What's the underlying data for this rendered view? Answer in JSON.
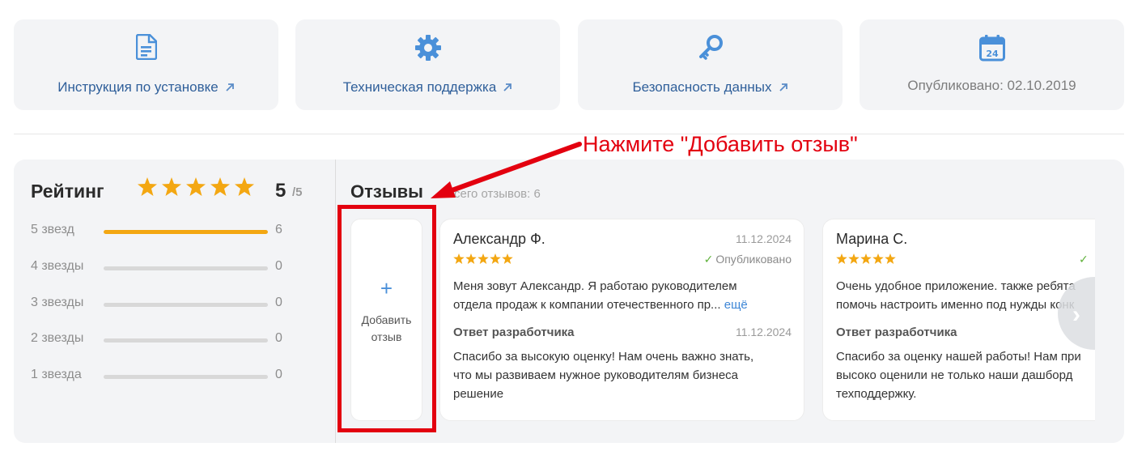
{
  "tiles": [
    {
      "label": "Инструкция по установке",
      "icon": "document-icon"
    },
    {
      "label": "Техническая поддержка",
      "icon": "gear-icon"
    },
    {
      "label": "Безопасность данных",
      "icon": "key-icon"
    },
    {
      "label": "Опубликовано: 02.10.2019",
      "icon": "calendar-icon",
      "calendar_day": "24"
    }
  ],
  "rating": {
    "title": "Рейтинг",
    "score": "5",
    "max": "/5",
    "rows": [
      {
        "label": "5 звезд",
        "count": "6",
        "fraction": 1.0
      },
      {
        "label": "4 звезды",
        "count": "0",
        "fraction": 0
      },
      {
        "label": "3 звезды",
        "count": "0",
        "fraction": 0
      },
      {
        "label": "2 звезды",
        "count": "0",
        "fraction": 0
      },
      {
        "label": "1 звезда",
        "count": "0",
        "fraction": 0
      }
    ]
  },
  "reviews": {
    "title": "Отзывы",
    "total": "Всего отзывов: 6",
    "add_label": "Добавить отзыв",
    "items": [
      {
        "author": "Александр Ф.",
        "date": "11.12.2024",
        "stars": 5,
        "status": "Опубликовано",
        "text_line1": "Меня зовут Александр. Я работаю руководителем",
        "text_line2": "отдела продаж к компании отечественного пр...",
        "more": "ещё",
        "answer_title": "Ответ разработчика",
        "answer_date": "11.12.2024",
        "answer_line1": "Спасибо за высокую оценку! Нам очень важно знать,",
        "answer_line2": "что мы развиваем нужное руководителям бизнеса",
        "answer_line3": "решение"
      },
      {
        "author": "Марина С.",
        "stars": 5,
        "text_line1": "Очень удобное приложение. также ребята",
        "text_line2": "помочь настроить именно под нужды конк",
        "answer_title": "Ответ разработчика",
        "answer_line1": "Спасибо за оценку нашей работы! Нам при",
        "answer_line2": "высоко оценили не только наши дашборд",
        "answer_line3": "техподдержку."
      }
    ]
  },
  "annotation": {
    "text": "Нажмите \"Добавить отзыв\"",
    "color": "#e3000f"
  },
  "colors": {
    "accent": "#2f5f9a",
    "icon_blue": "#4a90d9",
    "star": "#f3a712",
    "published_check": "#5fb13a"
  }
}
